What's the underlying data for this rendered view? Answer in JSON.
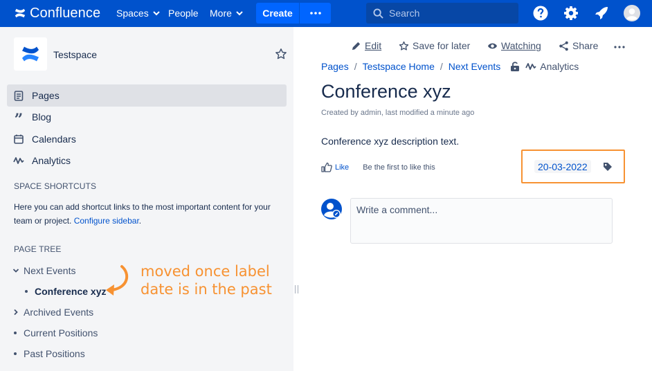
{
  "colors": {
    "nav_bg": "#0052cc",
    "button_bg": "#0065ff",
    "link": "#0052cc",
    "sidebar_bg": "#f4f5f7",
    "highlight": "#f79232"
  },
  "topnav": {
    "brand": "Confluence",
    "spaces_label": "Spaces",
    "people_label": "People",
    "more_label": "More",
    "create_label": "Create",
    "search_placeholder": "Search",
    "icons": [
      "help-icon",
      "settings-icon",
      "notifications-icon",
      "profile-avatar-icon"
    ]
  },
  "sidebar": {
    "space_name": "Testspace",
    "nav_items": [
      {
        "label": "Pages",
        "icon": "pages-icon",
        "active": true
      },
      {
        "label": "Blog",
        "icon": "blog-quote-icon"
      },
      {
        "label": "Calendars",
        "icon": "calendar-icon"
      },
      {
        "label": "Analytics",
        "icon": "analytics-icon"
      }
    ],
    "shortcuts_heading": "SPACE SHORTCUTS",
    "shortcuts_text": "Here you can add shortcut links to the most important content for your team or project.",
    "configure_link": "Configure sidebar",
    "tree_heading": "PAGE TREE",
    "tree": [
      {
        "label": "Next Events",
        "type": "expanded"
      },
      {
        "label": "Conference xyz",
        "type": "current"
      },
      {
        "label": "Archived Events",
        "type": "collapsed"
      },
      {
        "label": "Current Positions",
        "type": "leaf"
      },
      {
        "label": "Past Positions",
        "type": "leaf"
      }
    ],
    "annotation_line1": "moved once label",
    "annotation_line2": "date is in the past"
  },
  "page": {
    "actions": {
      "edit": "Edit",
      "save_for_later": "Save for later",
      "watching": "Watching",
      "share": "Share"
    },
    "breadcrumbs": [
      "Pages",
      "Testspace Home",
      "Next Events"
    ],
    "analytics_label": "Analytics",
    "title": "Conference xyz",
    "byline": "Created by admin, last modified a minute ago",
    "body": "Conference xyz description text.",
    "like_label": "Like",
    "like_note": "Be the first to like this",
    "date_label": "20-03-2022",
    "comment_placeholder": "Write a comment..."
  }
}
